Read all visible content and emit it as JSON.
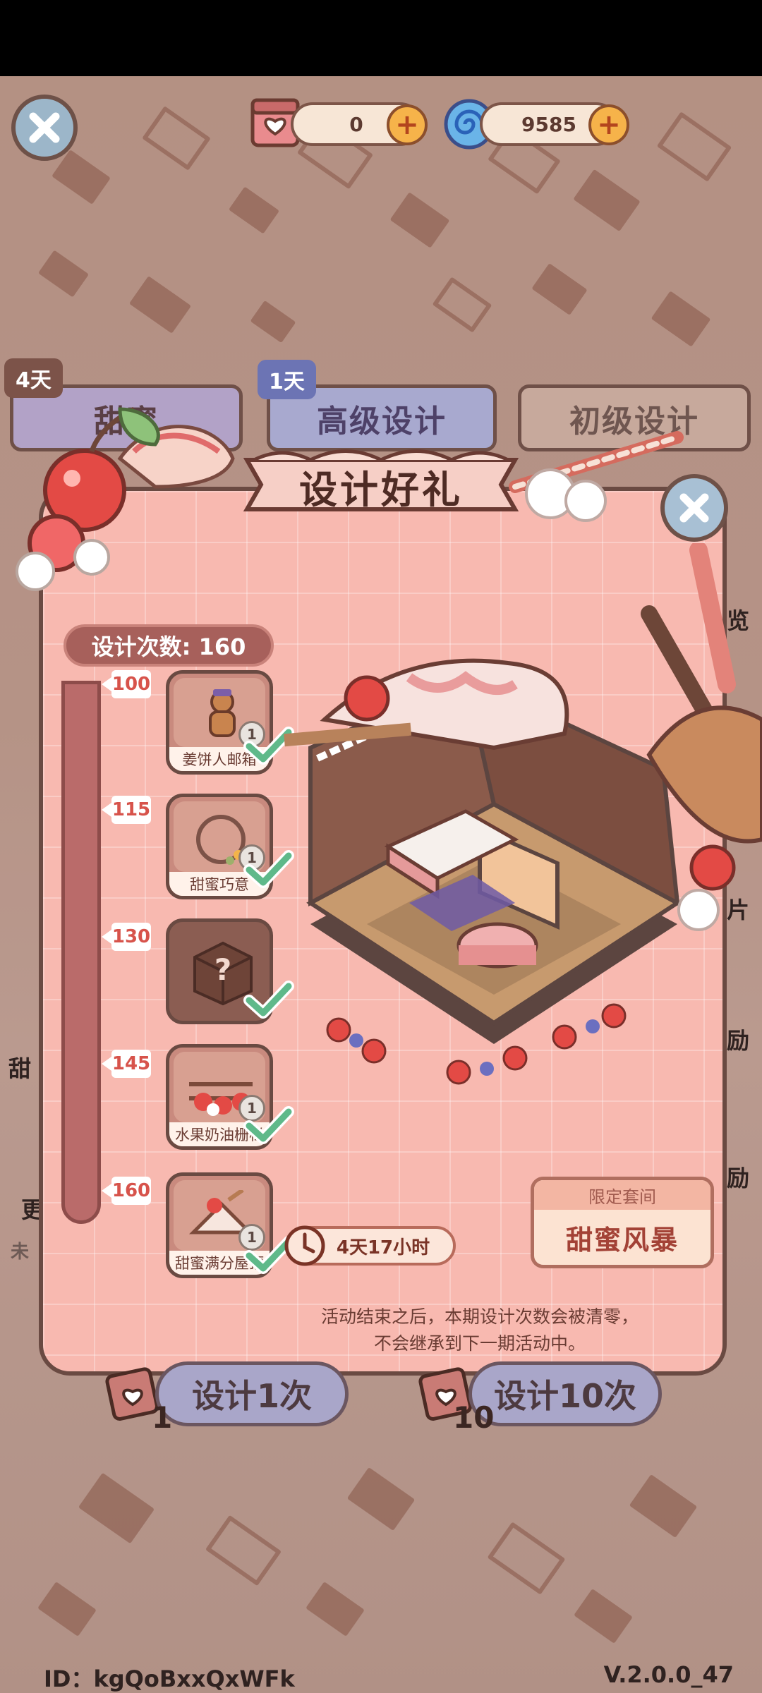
{
  "resources": {
    "coupon_count": "0",
    "candy_count": "9585",
    "coupon_icon": "gift-coupon-icon",
    "candy_icon": "swirl-candy-icon"
  },
  "tabs": [
    {
      "label": "甜蜜",
      "badge": "4天"
    },
    {
      "label": "高级设计",
      "badge": "1天"
    },
    {
      "label": "初级设计"
    }
  ],
  "modal": {
    "title": "设计好礼",
    "design_count_label": "设计次数: 160",
    "milestones": [
      {
        "value": "100",
        "reward": "姜饼人邮箱",
        "qty": "1",
        "claimed": true
      },
      {
        "value": "115",
        "reward": "甜蜜巧意",
        "qty": "1",
        "claimed": true
      },
      {
        "value": "130",
        "reward": "",
        "qty": "",
        "claimed": true,
        "mystery": true
      },
      {
        "value": "145",
        "reward": "水果奶油栅栏",
        "qty": "1",
        "claimed": true
      },
      {
        "value": "160",
        "reward": "甜蜜满分屋顶",
        "qty": "1",
        "claimed": true
      }
    ],
    "limited": {
      "label": "限定套间",
      "name": "甜蜜风暴"
    },
    "timer": "4天17小时",
    "note_line1": "活动结束之后，本期设计次数会被清零，",
    "note_line2": "不会继承到下一期活动中。"
  },
  "side_labels": {
    "right_1": "览",
    "right_2": "片",
    "right_3": "励",
    "right_4": "励",
    "left_1": "甜",
    "left_2": "更",
    "left_3": "未"
  },
  "buttons": {
    "design_once": "设计1次",
    "design_once_cost": "1",
    "design_ten": "设计10次",
    "design_ten_cost": "10"
  },
  "footer": {
    "id": "ID：kgQoBxxQxWFk",
    "version": "V.2.0.0_47"
  },
  "colors": {
    "modal_bg": "#f8b9b0",
    "accent_red": "#d7534b",
    "border_brown": "#6a4a42"
  }
}
